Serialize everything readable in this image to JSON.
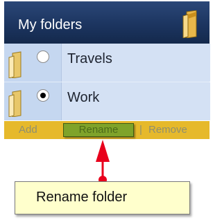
{
  "panel": {
    "title": "My folders",
    "folders": [
      {
        "label": "Travels",
        "selected": false
      },
      {
        "label": "Work",
        "selected": true
      }
    ]
  },
  "toolbar": {
    "add_label": "Add",
    "rename_label": "Rename",
    "remove_label": "Remove",
    "separator": "|"
  },
  "callout": {
    "text": "Rename folder"
  },
  "colors": {
    "header": "#1c3560",
    "row": "#c5d7f0",
    "toolbar": "#e6b92b",
    "highlight": "#7fa32a",
    "callout_bg": "#ffffcc",
    "marker": "#e8001c"
  },
  "icons": {
    "header": "folder-icon",
    "row": "folder-icon"
  }
}
